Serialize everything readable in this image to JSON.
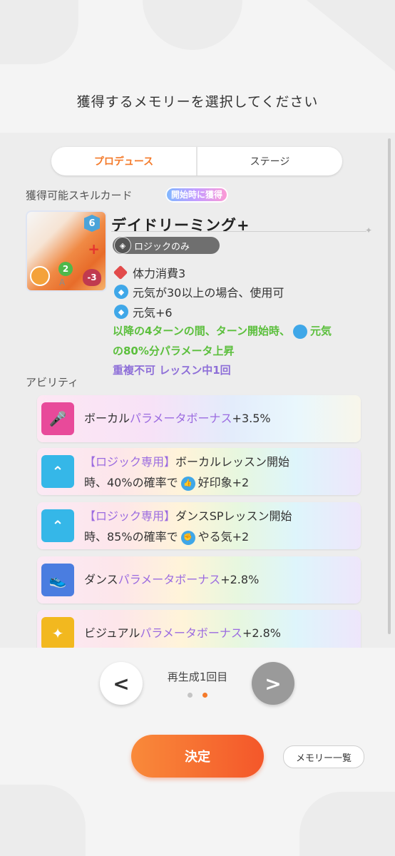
{
  "header": {
    "title": "獲得するメモリーを選択してください"
  },
  "tabs": [
    {
      "label": "プロデュース",
      "active": true
    },
    {
      "label": "ステージ",
      "active": false
    }
  ],
  "skill_section": {
    "label": "獲得可能スキルカード",
    "badge": "開始時に獲得",
    "card": {
      "name": "デイドリーミング+",
      "cost": "6",
      "green_badge": "2",
      "heart_badge": "-3",
      "letter": "A",
      "restriction": "ロジックのみ",
      "effects": [
        {
          "icon": "diamond-red-icon",
          "text": "体力消費3"
        },
        {
          "icon": "genki-icon",
          "text": "元気が30以上の場合、使用可"
        },
        {
          "icon": "genki-icon",
          "text": "元気+6"
        }
      ],
      "green_line1_a": "以降の4ターンの間、ターン開始時、",
      "green_line1_b": "元気",
      "green_line2": "の80%分パラメータ上昇",
      "purple_line": "重複不可 レッスン中1回"
    }
  },
  "ability_section": {
    "label": "アビリティ",
    "items": [
      {
        "icon": "vocal-icon",
        "color": "#e84a9a",
        "prefix": "ボーカル",
        "highlight": "パラメータボーナス",
        "suffix": "+3.5%"
      },
      {
        "icon": "logic-chevron-icon",
        "color": "#35b7e8",
        "tag": "【ロジック専用】",
        "line1": "ボーカルレッスン開始",
        "line2a": "時、40%の確率で",
        "buff": "好印象+2"
      },
      {
        "icon": "logic-chevron-icon",
        "color": "#35b7e8",
        "tag": "【ロジック専用】",
        "line1": "ダンスSPレッスン開始",
        "line2a": "時、85%の確率で",
        "buff": "やる気+2"
      },
      {
        "icon": "dance-icon",
        "color": "#4a7de0",
        "prefix": "ダンス",
        "highlight": "パラメータボーナス",
        "suffix": "+2.8%"
      },
      {
        "icon": "visual-icon",
        "color": "#f2b81f",
        "prefix": "ビジュアル",
        "highlight": "パラメータボーナス",
        "suffix": "+2.8%"
      }
    ]
  },
  "footer": {
    "regen_label": "再生成1回目",
    "prev_symbol": "<",
    "next_symbol": ">",
    "page_count": 2,
    "current_page": 2,
    "decide_label": "決定",
    "memory_list_label": "メモリー一覧"
  }
}
